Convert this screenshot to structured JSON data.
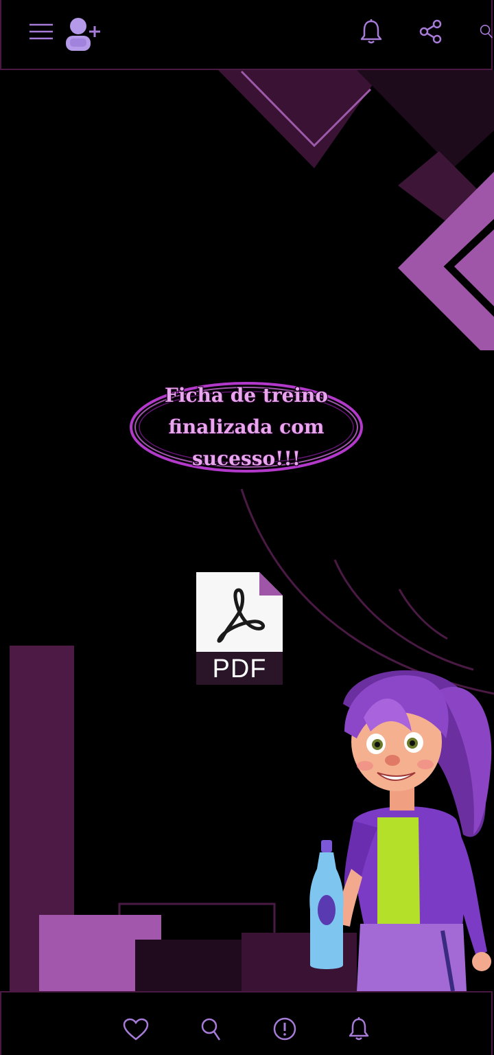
{
  "header": {
    "menu_icon": "hamburger-menu-icon",
    "add_user_icon": "add-user-icon",
    "notifications_icon": "bell-icon",
    "share_icon": "share-icon",
    "search_icon": "search-icon"
  },
  "message": {
    "text": "Ficha de treino finalizada com sucesso!!!"
  },
  "pdf": {
    "label": "PDF",
    "icon": "pdf-file-icon"
  },
  "bottom_nav": {
    "items": [
      {
        "icon": "heart-icon"
      },
      {
        "icon": "search-icon"
      },
      {
        "icon": "alert-circle-icon"
      },
      {
        "icon": "bell-icon"
      }
    ]
  },
  "colors": {
    "background": "#000000",
    "accent": "#a77bd8",
    "bar_border": "#4a1a44",
    "deco_light": "#a257ac",
    "deco_mid": "#4d1a45",
    "deco_dark": "#200a1e",
    "neon": "#c63fe0"
  }
}
